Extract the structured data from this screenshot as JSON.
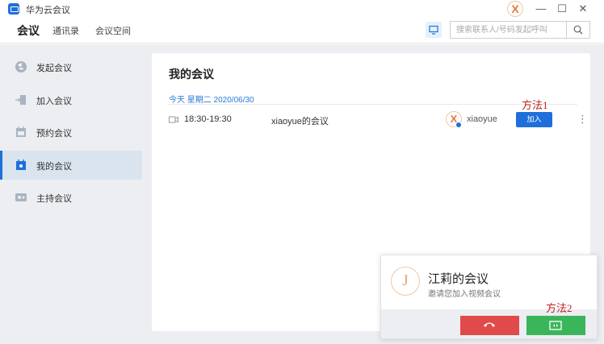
{
  "app": {
    "title": "华为云会议"
  },
  "window": {
    "user_initial": "X",
    "minimize": "—",
    "maximize": "☐",
    "close": "✕"
  },
  "topnav": {
    "tabs": [
      {
        "label": "会议"
      },
      {
        "label": "通讯录"
      },
      {
        "label": "会议空间"
      }
    ],
    "search": {
      "placeholder": "搜索联系人/号码发起呼叫"
    }
  },
  "sidebar": {
    "items": [
      {
        "label": "发起会议"
      },
      {
        "label": "加入会议"
      },
      {
        "label": "预约会议"
      },
      {
        "label": "我的会议"
      },
      {
        "label": "主持会议"
      }
    ]
  },
  "main": {
    "title": "我的会议",
    "date_label": "今天 星期二 2020/06/30",
    "meetings": [
      {
        "time": "18:30-19:30",
        "subject": "xiaoyue的会议",
        "host_initial": "X",
        "host": "xiaoyue",
        "join_label": "加入",
        "more": "⋮"
      }
    ]
  },
  "annotations": {
    "method1": "方法1",
    "method2": "方法2"
  },
  "incoming_call": {
    "caller_initial": "J",
    "title": "江莉的会议",
    "description": "邀请您加入视频会议"
  },
  "colors": {
    "accent": "#1e6fd9",
    "decline": "#e14a4a",
    "accept": "#3bb559",
    "annotation": "#c0211d"
  }
}
